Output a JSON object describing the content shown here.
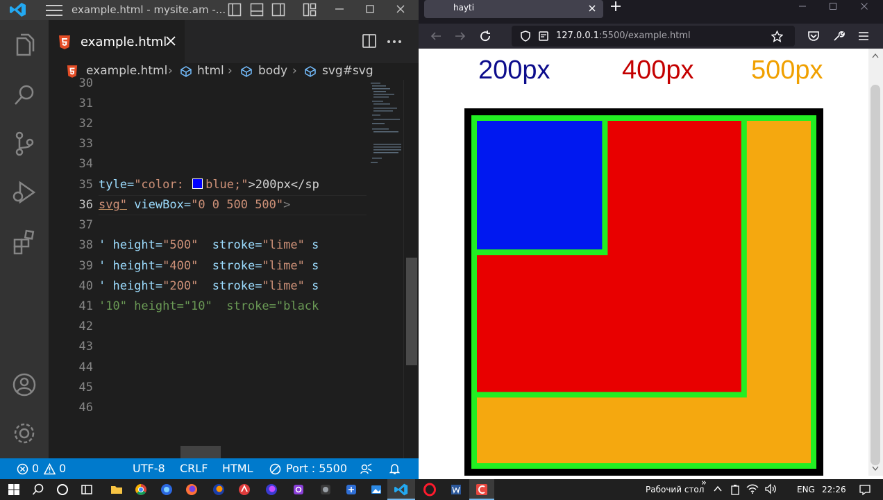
{
  "vscode": {
    "window_title": "example.html - mysite.am -...",
    "tab_label": "example.html",
    "breadcrumb": [
      "example.html",
      "html",
      "body",
      "svg#svg"
    ],
    "line_numbers": [
      "30",
      "31",
      "32",
      "33",
      "34",
      "35",
      "36",
      "37",
      "38",
      "39",
      "40",
      "41",
      "42",
      "43",
      "44",
      "45",
      "46"
    ],
    "active_line": "36",
    "code": {
      "l35": {
        "a": "tyle=",
        "b": "\"color: ",
        "c": "blue;\"",
        "d": ">200px</sp"
      },
      "l36": {
        "a": "svg\"",
        "b": " viewBox=",
        "c": "\"0 0 500 500\"",
        "d": ">"
      },
      "l38": {
        "a": "' height=",
        "b": "\"500\"",
        "c": "  stroke=",
        "d": "\"lime\"",
        "e": " s"
      },
      "l39": {
        "a": "' height=",
        "b": "\"400\"",
        "c": "  stroke=",
        "d": "\"lime\"",
        "e": " s"
      },
      "l40": {
        "a": "' height=",
        "b": "\"200\"",
        "c": "  stroke=",
        "d": "\"lime\"",
        "e": " s"
      },
      "l41": {
        "text": "'10\" height=\"10\"  stroke=\"black"
      }
    },
    "status": {
      "errors": "0",
      "warnings": "0",
      "encoding": "UTF-8",
      "eol": "CRLF",
      "language": "HTML",
      "port": "Port : 5500"
    },
    "colors": {
      "accent": "#007acc",
      "swatch": "#0000ff"
    }
  },
  "browser": {
    "tab_label": "hayti",
    "url_host": "127.0.0.1",
    "url_path": ":5500/example.html",
    "labels": [
      {
        "text": "200px",
        "color": "#0c0c8c"
      },
      {
        "text": "400px",
        "color": "#c40000"
      },
      {
        "text": "500px",
        "color": "#f0a000"
      }
    ],
    "rects": [
      {
        "size": 500,
        "fill": "#f5a80f"
      },
      {
        "size": 400,
        "fill": "#e80000"
      },
      {
        "size": 200,
        "fill": "#0018f0"
      }
    ],
    "stroke": "#22ee22",
    "frame": "#000000"
  },
  "taskbar": {
    "desktop_label": "Рабочий стол",
    "lang": "ENG",
    "time": "22:26"
  }
}
